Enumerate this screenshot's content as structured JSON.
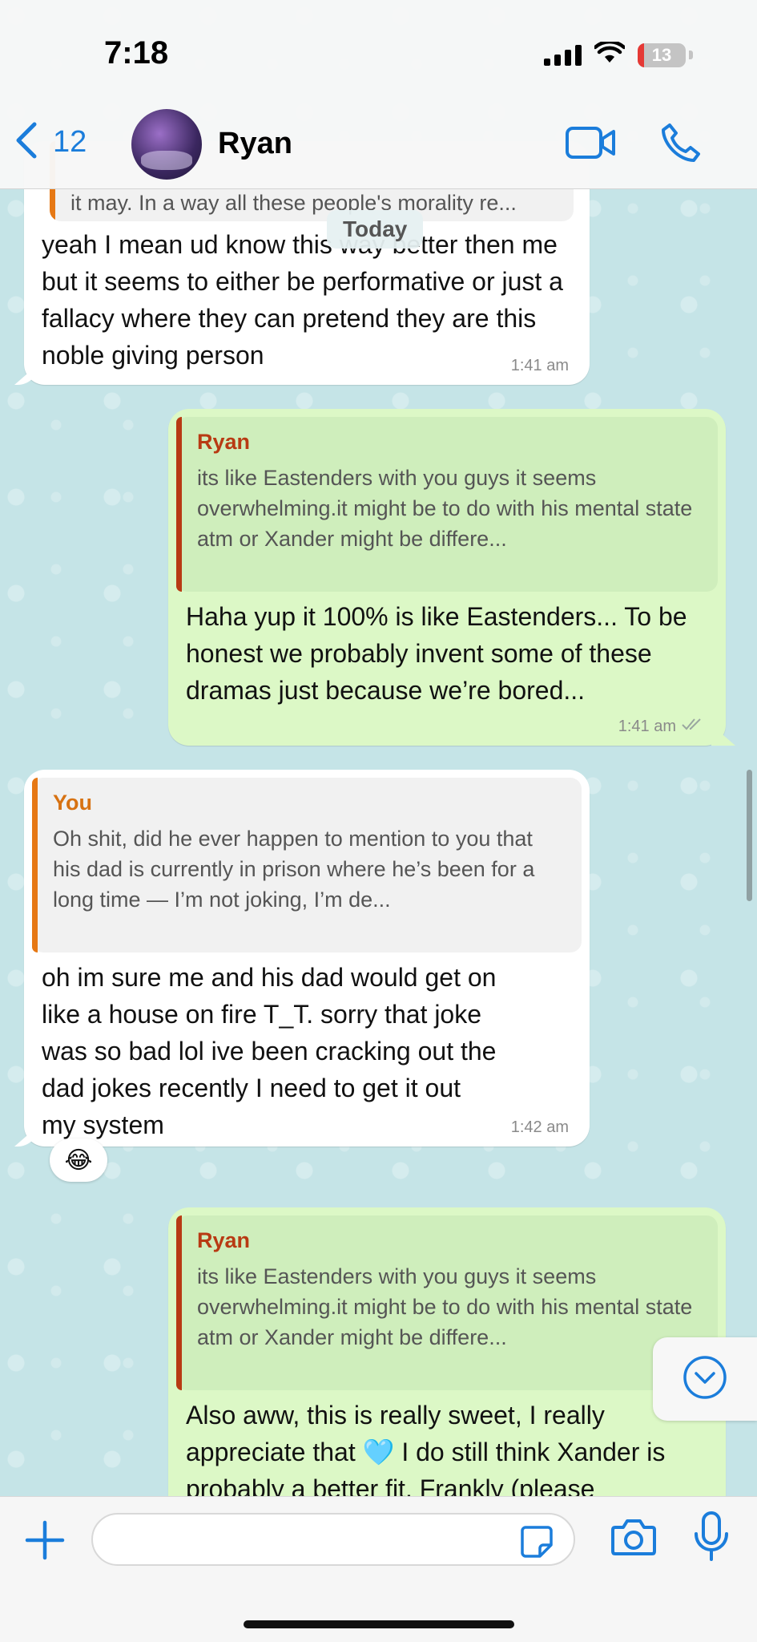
{
  "status_bar": {
    "time": "7:18",
    "battery": "13",
    "battery_color": "#e53935"
  },
  "header": {
    "back_count": "12",
    "contact_name": "Ryan",
    "accent": "#1b7ddb"
  },
  "chat": {
    "date_label": "Today",
    "prev_quote_fragment": "it may. In a way all these people's morality re...",
    "messages": [
      {
        "text": "yeah I mean ud know this way better then me but it seems to either be performative or just a fallacy where they can pretend they are this noble giving person",
        "time": "1:41 am"
      },
      {
        "quote_author": "Ryan",
        "quote_text": "its like Eastenders with you guys it seems overwhelming.it might be to do with his mental state atm or Xander might be differe...",
        "text": "Haha yup it 100% is like Eastenders... To be honest we probably invent some of these dramas just because we’re bored...",
        "time": "1:41 am"
      },
      {
        "quote_author": "You",
        "quote_text": "Oh shit, did he ever happen to mention to you that his dad is currently in prison where he’s been for a long time — I’m not joking, I’m de...",
        "text": "oh im sure me and his dad would get on like a house on fire T_T. sorry that joke was so bad lol ive been cracking out the dad jokes recently I need to get it out my system",
        "time": "1:42 am",
        "reaction": "😂"
      },
      {
        "quote_author": "Ryan",
        "quote_text": "its like Eastenders with you guys it seems overwhelming.it might be to do with his mental state atm or Xander might be differe...",
        "text": "Also aww, this is really sweet, I really appreciate that 🩵 I do still think Xander is probably a better fit. Frankly (please"
      }
    ]
  },
  "composer": {
    "placeholder": ""
  }
}
